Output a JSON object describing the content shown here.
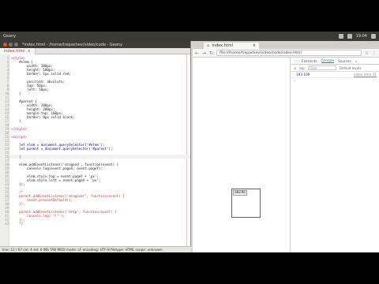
{
  "topbar": {
    "app": "Geany",
    "clock": "19:04"
  },
  "geany": {
    "title": "*index.html - /home/trepachev/video/code - Geany",
    "tab_label": "index.html",
    "lines": [
      {
        "n": "1",
        "t": "<style>",
        "k": "tag"
      },
      {
        "n": "2",
        "t": "    #elem {",
        "k": ""
      },
      {
        "n": "3",
        "t": "        width: 100px;",
        "k": ""
      },
      {
        "n": "4",
        "t": "        height: 100px;",
        "k": ""
      },
      {
        "n": "5",
        "t": "        border: 1px solid red;",
        "k": ""
      },
      {
        "n": "6",
        "t": "",
        "k": ""
      },
      {
        "n": "7",
        "t": "        position: absolute;",
        "k": ""
      },
      {
        "n": "8",
        "t": "        top: 50px;",
        "k": ""
      },
      {
        "n": "9",
        "t": "        left: 50px;",
        "k": ""
      },
      {
        "n": "10",
        "t": "    }",
        "k": ""
      },
      {
        "n": "11",
        "t": "",
        "k": ""
      },
      {
        "n": "12",
        "t": "    #parent {",
        "k": ""
      },
      {
        "n": "13",
        "t": "        width: 200px;",
        "k": ""
      },
      {
        "n": "14",
        "t": "        height: 200px;",
        "k": ""
      },
      {
        "n": "15",
        "t": "        margin-top: 100px;",
        "k": ""
      },
      {
        "n": "16",
        "t": "        border: 0px solid black;",
        "k": ""
      },
      {
        "n": "17",
        "t": "    }",
        "k": ""
      },
      {
        "n": "18",
        "t": "",
        "k": ""
      },
      {
        "n": "19",
        "t": "</style>",
        "k": "tag"
      },
      {
        "n": "20",
        "t": "",
        "k": ""
      },
      {
        "n": "21",
        "t": "<script>",
        "k": "tag"
      },
      {
        "n": "22",
        "t": "",
        "k": ""
      },
      {
        "n": "23",
        "t": "    let elem = document.querySelector('#elem');",
        "k": "kw"
      },
      {
        "n": "24",
        "t": "    let parent = document.querySelector('#parent');",
        "k": "kw"
      },
      {
        "n": "25",
        "t": "",
        "k": ""
      },
      {
        "n": "26",
        "t": "    |",
        "k": ""
      },
      {
        "n": "27",
        "t": "",
        "k": ""
      },
      {
        "n": "28",
        "t": "    elem.addEventListener('dragend', function(event) {",
        "k": ""
      },
      {
        "n": "29",
        "t": "        console.log(event.pageX, event.pageY);",
        "k": ""
      },
      {
        "n": "30",
        "t": "",
        "k": ""
      },
      {
        "n": "31",
        "t": "        elem.style.top = event.pageY + 'px';",
        "k": ""
      },
      {
        "n": "32",
        "t": "        elem.style.left = event.pageX + 'px';",
        "k": ""
      },
      {
        "n": "33",
        "t": "    });",
        "k": ""
      },
      {
        "n": "34",
        "t": "",
        "k": ""
      },
      {
        "n": "35",
        "t": "    /*",
        "k": "cmt"
      },
      {
        "n": "36",
        "t": "    parent.addEventListener('dragover', function(event) {",
        "k": "cmt"
      },
      {
        "n": "37",
        "t": "        event.preventDefault();",
        "k": "cmt"
      },
      {
        "n": "38",
        "t": "    });",
        "k": "cmt"
      },
      {
        "n": "39",
        "t": "",
        "k": ""
      },
      {
        "n": "40",
        "t": "    parent.addEventListener('drop', function(event) {",
        "k": "cmt"
      },
      {
        "n": "41",
        "t": "        console.log('!!!');",
        "k": "cmt"
      },
      {
        "n": "42",
        "t": "    });",
        "k": "cmt"
      },
      {
        "n": "43",
        "t": "    */",
        "k": "cmt"
      }
    ],
    "status": "line: 12 / 67    col: 4    sel: 0    INS    TAB    MOD    mode: LF    encoding: UTF-8    filetype: HTML    scope: unknown"
  },
  "browser": {
    "tab_title": "index.html",
    "url": "file:///home/trepachev/video/code/index.html",
    "page_box_text": "abcde",
    "devtools": {
      "tabs": [
        "Elements",
        "Console",
        "Sources"
      ],
      "selected_tab": "Console",
      "context": "top",
      "filter_placeholder": "Filter",
      "levels": "Default levels",
      "console_values": "193  109",
      "console_source": "index.html:31"
    }
  }
}
